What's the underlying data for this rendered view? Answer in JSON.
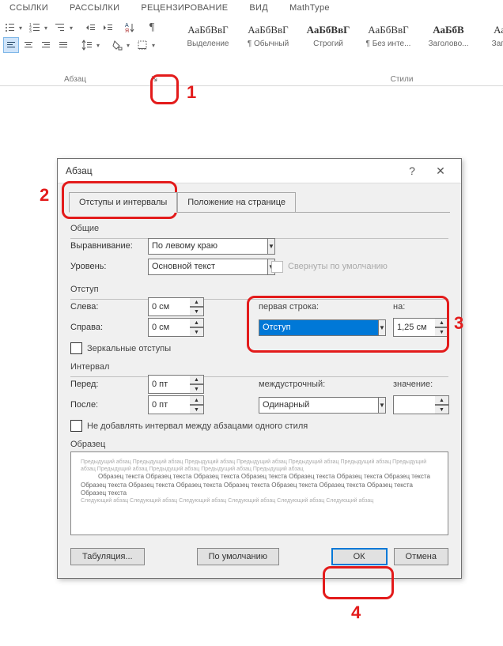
{
  "ribbon_tabs": [
    "ССЫЛКИ",
    "РАССЫЛКИ",
    "РЕЦЕНЗИРОВАНИЕ",
    "ВИД",
    "MathType"
  ],
  "group_para": "Абзац",
  "group_styles": "Стили",
  "styles": [
    {
      "sample": "АаБбВвГ",
      "name": "Выделение",
      "bold": false
    },
    {
      "sample": "АаБбВвГ",
      "name": "¶ Обычный",
      "bold": false
    },
    {
      "sample": "АаБбВвГ",
      "name": "Строгий",
      "bold": true
    },
    {
      "sample": "АаБбВвГ",
      "name": "¶ Без инте...",
      "bold": false
    },
    {
      "sample": "АаБбВ",
      "name": "Заголово...",
      "bold": true
    },
    {
      "sample": "АаБбВ",
      "name": "Заголово",
      "bold": false
    }
  ],
  "dialog": {
    "title": "Абзац",
    "tab_indent": "Отступы и интервалы",
    "tab_page": "Положение на странице",
    "section_common": "Общие",
    "section_indent": "Отступ",
    "section_interval": "Интервал",
    "section_preview": "Образец",
    "align_label": "Выравнивание:",
    "align_value": "По левому краю",
    "level_label": "Уровень:",
    "level_value": "Основной текст",
    "collapse_label": "Свернуты по умолчанию",
    "left_label": "Слева:",
    "left_value": "0 см",
    "right_label": "Справа:",
    "right_value": "0 см",
    "firstline_label": "первая строка:",
    "firstline_value": "Отступ",
    "by_label": "на:",
    "by_value": "1,25 см",
    "mirror_label": "Зеркальные отступы",
    "before_label": "Перед:",
    "before_value": "0 пт",
    "after_label": "После:",
    "after_value": "0 пт",
    "line_label": "междустрочный:",
    "line_value": "Одинарный",
    "value_label": "значение:",
    "value_value": "",
    "noadd_label": "Не добавлять интервал между абзацами одного стиля",
    "preview_top": "Предыдущий абзац Предыдущий абзац Предыдущий абзац Предыдущий абзац Предыдущий абзац Предыдущий абзац Предыдущий абзац Предыдущий абзац Предыдущий абзац Предыдущий абзац Предыдущий абзац",
    "preview_center": "Образец текста Образец текста Образец текста Образец текста Образец текста Образец текста Образец текста Образец текста Образец текста Образец текста Образец текста Образец текста Образец текста Образец текста Образец текста",
    "preview_bottom": "Следующий абзац Следующий абзац Следующий абзац Следующий абзац Следующий абзац Следующий абзац",
    "tabulation_btn": "Табуляция...",
    "default_btn": "По умолчанию",
    "ok_btn": "ОК",
    "cancel_btn": "Отмена"
  },
  "annotations": {
    "1": "1",
    "2": "2",
    "3": "3",
    "4": "4"
  }
}
